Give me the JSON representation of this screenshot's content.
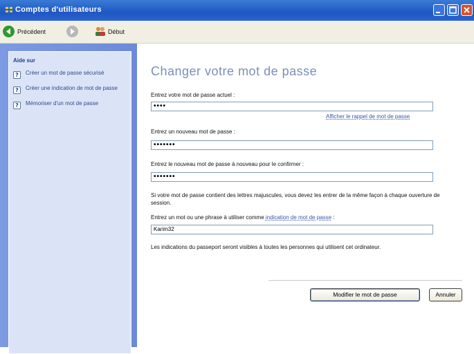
{
  "window": {
    "title": "Comptes d'utilisateurs"
  },
  "toolbar": {
    "back_label": "Précédent",
    "home_label": "Début"
  },
  "sidebar": {
    "header": "Aide sur",
    "items": [
      {
        "label": "Créer un mot de passe sécurisé"
      },
      {
        "label": "Créer une indication de mot de passe"
      },
      {
        "label": "Mémoriser d'un mot de passe"
      }
    ]
  },
  "main": {
    "title": "Changer votre mot de passe",
    "current_label": "Entrez votre mot de passe actuel :",
    "current_value": "••••",
    "hint_link": "Afficher le rappel de mot de passe",
    "new_label": "Entrez un nouveau mot de passe :",
    "new_value": "•••••••",
    "confirm_label": "Entrez le nouveau mot de passe à nouveau pour le confirmer :",
    "confirm_value": "•••••••",
    "case_note": "Si votre mot de passe contient des lettres majuscules, vous devez les entrer de la même façon à chaque ouverture de session.",
    "hint_label_prefix": "Entrez un mot ou une phrase à utiliser comme",
    "hint_label_link": "indication de mot de passe",
    "hint_label_suffix": ":",
    "hint_value": "Karim32",
    "visibility_note": "Les indications du passeport seront visibles à toutes les personnes qui utilisent cet ordinateur.",
    "submit_label": "Modifier le mot de passe",
    "cancel_label": "Annuler"
  }
}
